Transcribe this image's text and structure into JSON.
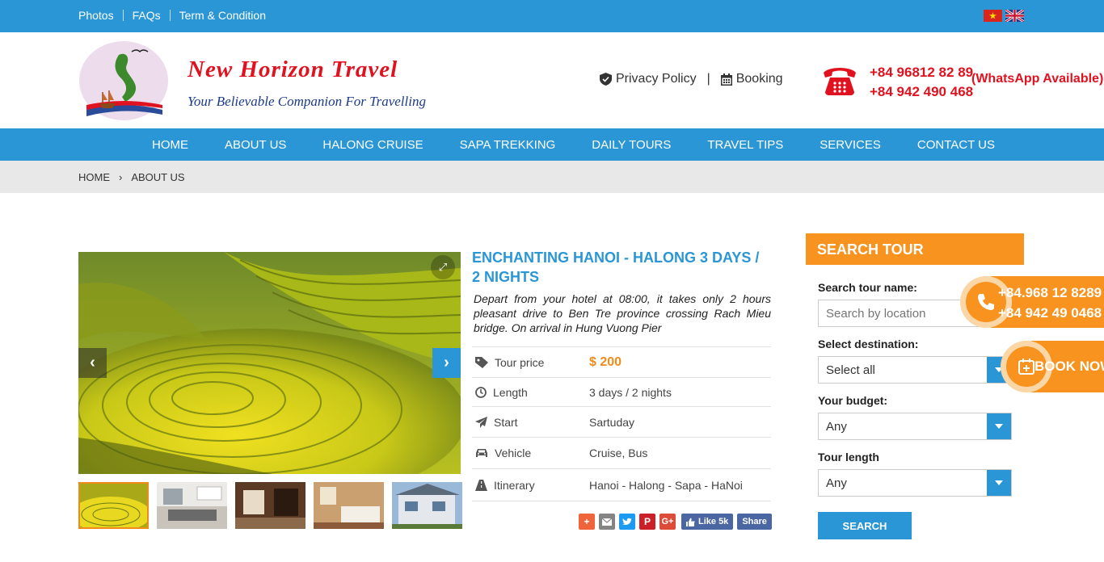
{
  "topbar": {
    "links": [
      "Photos",
      "FAQs",
      "Term & Condition"
    ],
    "flags": [
      "vietnam-flag-icon",
      "uk-flag-icon"
    ]
  },
  "header": {
    "brand": "New Horizon Travel",
    "tagline": "Your Believable Companion For Travelling",
    "privacy_label": "Privacy Policy",
    "booking_label": "Booking",
    "phone_1": "+84 96812 82 89",
    "phone_2": "+84 942 490 468",
    "whatsapp": "(WhatsApp Available)"
  },
  "nav": {
    "items": [
      "HOME",
      "ABOUT US",
      "HALONG CRUISE",
      "SAPA TREKKING",
      "DAILY TOURS",
      "TRAVEL TIPS",
      "SERVICES",
      "CONTACT US"
    ]
  },
  "breadcrumb": {
    "items": [
      "HOME",
      "ABOUT US"
    ]
  },
  "tour": {
    "title": "ENCHANTING HANOI - HALONG 3 DAYS / 2 NIGHTS",
    "description": "Depart from your hotel at 08:00, it takes only 2 hours pleasant drive to Ben Tre province crossing Rach Mieu bridge. On arrival in Hung Vuong Pier",
    "details": [
      {
        "label": "Tour price",
        "value": "$ 200",
        "icon": "tag-icon"
      },
      {
        "label": "Length",
        "value": "3 days / 2 nights",
        "icon": "clock-icon"
      },
      {
        "label": "Start",
        "value": "Sartuday",
        "icon": "paper-plane-icon"
      },
      {
        "label": "Vehicle",
        "value": "Cruise, Bus",
        "icon": "car-icon"
      },
      {
        "label": "Itinerary",
        "value": "Hanoi - Halong - Sapa - HaNoi",
        "icon": "road-icon"
      }
    ],
    "share": {
      "like_label": "Like 5k",
      "share_label": "Share"
    }
  },
  "search": {
    "heading": "SEARCH TOUR",
    "name_label": "Search tour name:",
    "name_placeholder": "Search by location",
    "destination_label": "Select destination:",
    "destination_value": "Select all",
    "budget_label": "Your budget:",
    "budget_value": "Any",
    "length_label": "Tour length",
    "length_value": "Any",
    "button_label": "SEARCH"
  },
  "floating": {
    "phone_1": "+84.968 12 8289",
    "phone_2": "+84 942 49 0468",
    "book_label": "BOOK NOW"
  },
  "colors": {
    "primary_blue": "#2a96d6",
    "accent_orange": "#f7931e",
    "brand_red": "#e0121f"
  }
}
